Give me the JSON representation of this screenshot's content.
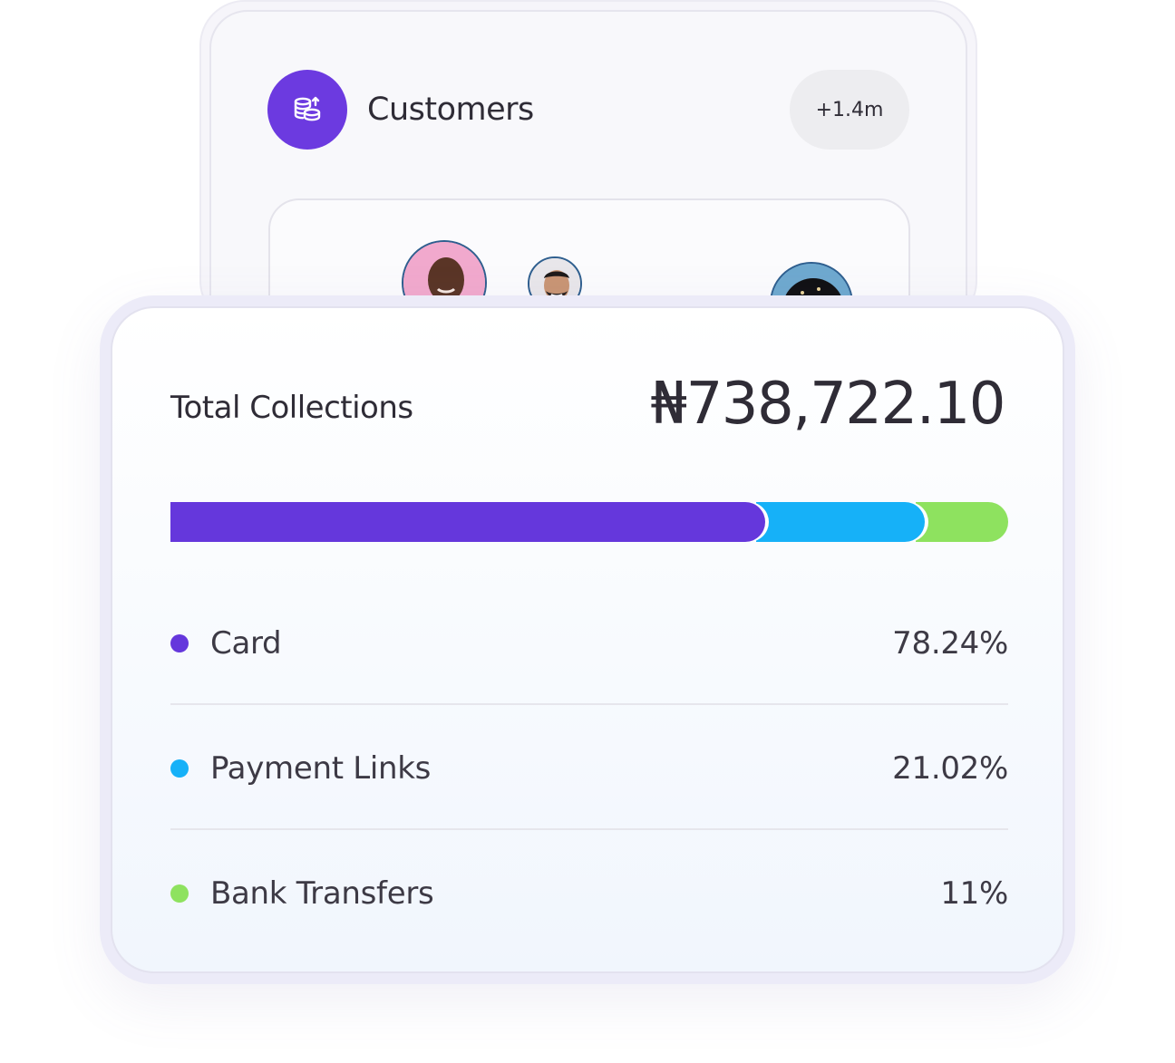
{
  "customers": {
    "title": "Customers",
    "badge": "+1.4m",
    "icon": "coins-stack-icon",
    "accent": "#6c3ae0"
  },
  "collections": {
    "label": "Total Collections",
    "amount": "₦738,722.10"
  },
  "chart_data": {
    "type": "bar",
    "categories": [
      "Card",
      "Payment Links",
      "Bank Transfers"
    ],
    "values": [
      78.24,
      21.02,
      11
    ],
    "colors": [
      "#6537dc",
      "#16b1f8",
      "#8ee25f"
    ]
  },
  "breakdown": [
    {
      "name": "Card",
      "percent": "78.24%",
      "color": "#6537dc"
    },
    {
      "name": "Payment Links",
      "percent": "21.02%",
      "color": "#16b1f8"
    },
    {
      "name": "Bank Transfers",
      "percent": "11%",
      "color": "#8ee25f"
    }
  ]
}
